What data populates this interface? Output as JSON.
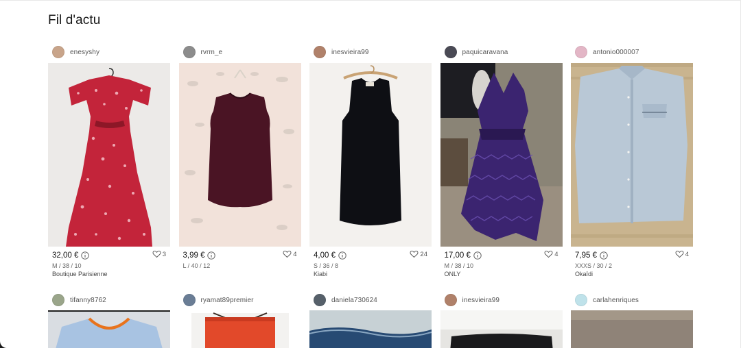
{
  "page": {
    "title": "Fil d'actu"
  },
  "feed": [
    {
      "user": "enesyshy",
      "price": "32,00 €",
      "likes": "3",
      "details": "M / 38 / 10",
      "brand": "Boutique Parisienne",
      "avatar_color": "#c8a48a",
      "photo": "red-floral-maxi-dress"
    },
    {
      "user": "rvrm_e",
      "price": "3,99 €",
      "likes": "4",
      "details": "L / 40 / 12",
      "brand": "",
      "avatar_color": "#8c8c8c",
      "photo": "burgundy-tank-top"
    },
    {
      "user": "inesvieira99",
      "price": "4,00 €",
      "likes": "24",
      "details": "S / 36 / 8",
      "brand": "Kiabi",
      "avatar_color": "#b0816a",
      "photo": "black-velvet-dress"
    },
    {
      "user": "paquicaravana",
      "price": "17,00 €",
      "likes": "4",
      "details": "M / 38 / 10",
      "brand": "ONLY",
      "avatar_color": "#4a4a55",
      "photo": "purple-chiffon-dress"
    },
    {
      "user": "antonio000007",
      "price": "7,95 €",
      "likes": "4",
      "details": "XXXS / 30 / 2",
      "brand": "Okaïdi",
      "avatar_color": "#e3b6c6",
      "photo": "light-blue-shirt"
    }
  ],
  "feed_row2": [
    {
      "user": "tifanny8762",
      "avatar_color": "#9aa58a",
      "photo": "light-blue-top-orange-trim"
    },
    {
      "user": "ryamat89premier",
      "avatar_color": "#6a7d95",
      "photo": "orange-skirt"
    },
    {
      "user": "daniela730624",
      "avatar_color": "#56606a",
      "photo": "denim-jeans"
    },
    {
      "user": "inesvieira99",
      "avatar_color": "#b0816a",
      "photo": "black-shorts"
    },
    {
      "user": "carlahenriques",
      "avatar_color": "#bfe2ea",
      "photo": "taupe-fabric"
    }
  ],
  "icons": {
    "info": "info-icon",
    "heart": "heart-icon"
  },
  "colors": {
    "text": "#171717",
    "muted": "#666666",
    "background": "#ffffff"
  }
}
